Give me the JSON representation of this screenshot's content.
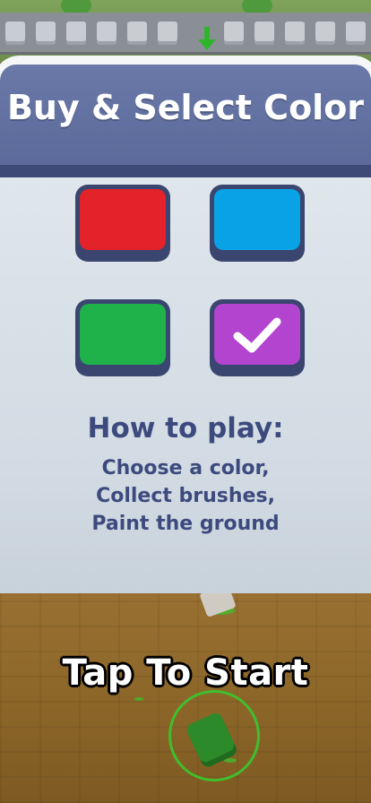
{
  "panel": {
    "title": "Buy & Select Color",
    "colors": [
      {
        "name": "red",
        "hex": "#e32229",
        "selected": false
      },
      {
        "name": "blue",
        "hex": "#0aa2e6",
        "selected": false
      },
      {
        "name": "green",
        "hex": "#1fb24a",
        "selected": false
      },
      {
        "name": "purple",
        "hex": "#b344cf",
        "selected": true
      }
    ],
    "howto_heading": "How to play:",
    "howto_lines": [
      "Choose a color,",
      "Collect brushes,",
      "Paint the ground"
    ]
  },
  "game": {
    "tap_to_start": "Tap To Start"
  }
}
